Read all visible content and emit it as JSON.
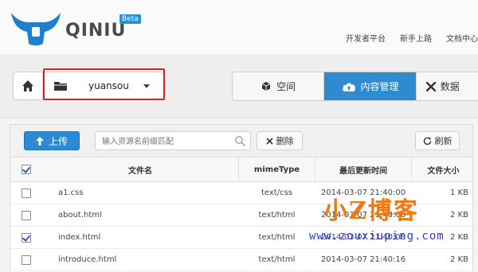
{
  "brand": {
    "logo_text": "QINIU",
    "badge": "Beta"
  },
  "top_nav": [
    "开发者平台",
    "新手上路",
    "文档中心"
  ],
  "bucket_selector": {
    "selected": "yuansou"
  },
  "tabs": [
    {
      "label": "空间",
      "icon": "cubes-icon",
      "active": false
    },
    {
      "label": "内容管理",
      "icon": "cloud-upload-icon",
      "active": true
    },
    {
      "label": "数据",
      "icon": "tools-icon",
      "active": false
    }
  ],
  "toolbar": {
    "upload_label": "上传",
    "search_placeholder": "输入资源名前缀匹配",
    "delete_label": "删除",
    "refresh_label": "刷新"
  },
  "table": {
    "headers": [
      "文件名",
      "mimeType",
      "最后更新时间",
      "文件大小"
    ],
    "rows": [
      {
        "name": "a1.css",
        "mime": "text/css",
        "updated": "2014-03-07 21:40:00",
        "size": "1 KB",
        "checked": false
      },
      {
        "name": "about.html",
        "mime": "text/html",
        "updated": "2014-03-07 21:40:08",
        "size": "2 KB",
        "checked": false
      },
      {
        "name": "index.html",
        "mime": "text/html",
        "updated": "2014-03-07 21:40:08",
        "size": "2 KB",
        "checked": true
      },
      {
        "name": "introduce.html",
        "mime": "text/html",
        "updated": "2014-03-07 21:40:16",
        "size": "2 KB",
        "checked": false
      }
    ]
  },
  "watermark": {
    "title": "小Z博客",
    "url": "www.zouxiuping.com"
  },
  "colors": {
    "primary": "#2f8ad0",
    "highlight_box": "#d62222",
    "watermark_title": "#f07a12",
    "watermark_url": "#2a3de0"
  }
}
